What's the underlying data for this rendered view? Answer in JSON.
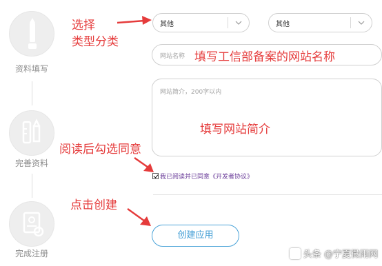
{
  "steps": [
    {
      "label": "资料填写",
      "icon": "pencil-icon"
    },
    {
      "label": "完善资料",
      "icon": "tools-icon"
    },
    {
      "label": "完成注册",
      "icon": "certificate-icon"
    }
  ],
  "form": {
    "type_select_1": "其他",
    "type_select_2": "其他",
    "site_name_placeholder": "网站名称",
    "site_intro_placeholder": "网站简介，200字以内",
    "agree_text": "我已阅读并已同意《开发者协议》",
    "create_button": "创建应用"
  },
  "annotations": {
    "select_type_line1": "选择",
    "select_type_line2": "类型分类",
    "fill_site_name": "填写工信部备案的网站名称",
    "fill_site_intro": "填写网站简介",
    "read_and_check": "阅读后勾选同意",
    "click_create": "点击创建"
  },
  "watermark": "头条 @宁夏微雨网",
  "colors": {
    "annotation": "#e53b3b",
    "button_border": "#4aa3d8",
    "agree_link": "#6a3c99"
  }
}
